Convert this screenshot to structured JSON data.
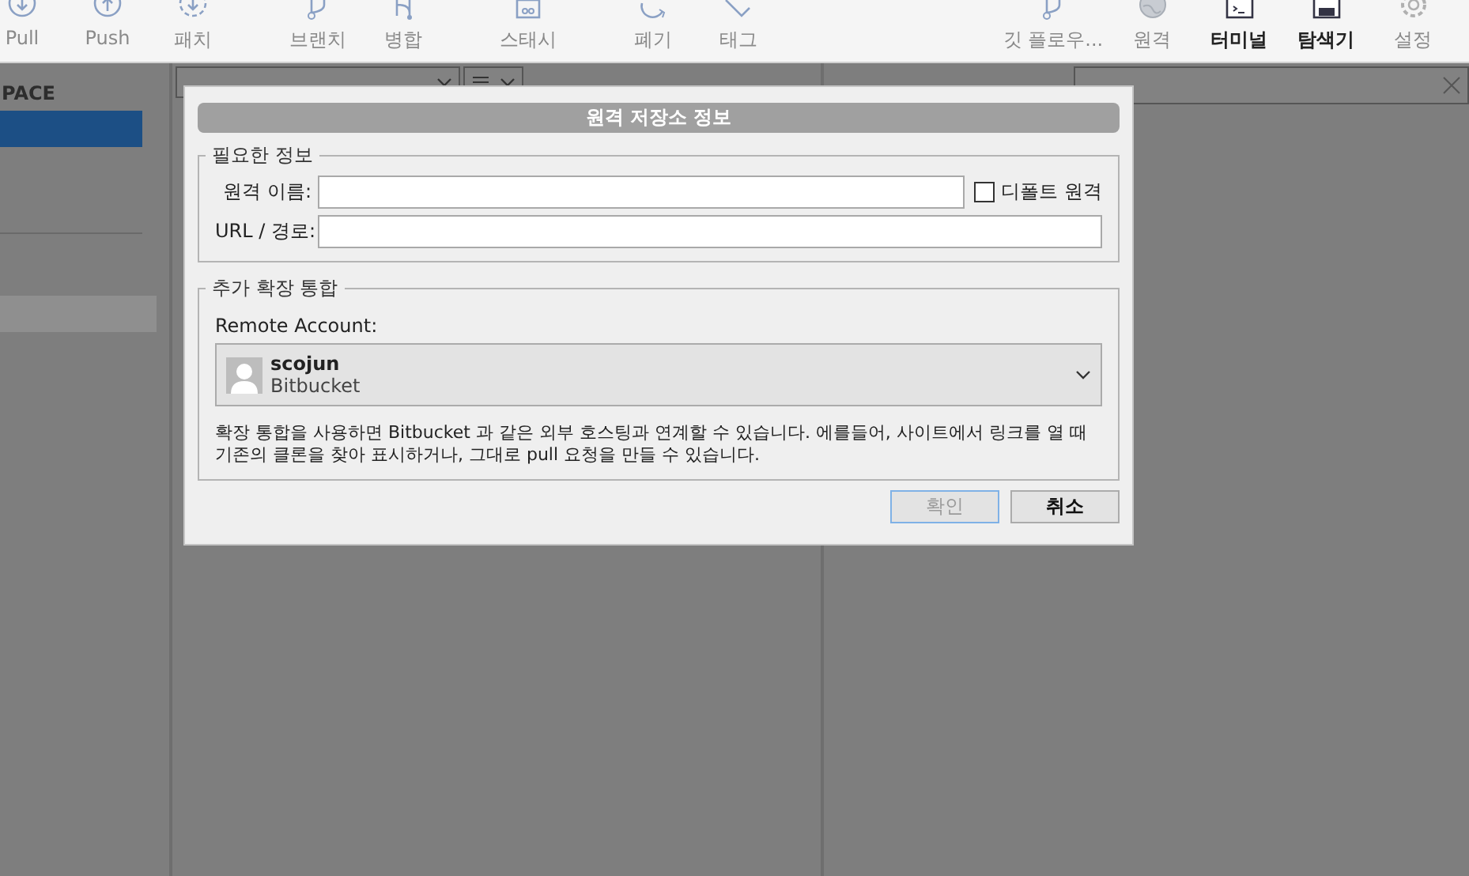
{
  "toolbar": {
    "left_groups": [
      [
        {
          "label": "Pull",
          "disabled": true
        },
        {
          "label": "Push",
          "disabled": true
        },
        {
          "label": "패치",
          "disabled": true
        }
      ],
      [
        {
          "label": "브랜치",
          "disabled": true
        },
        {
          "label": "병합",
          "disabled": true
        }
      ],
      [
        {
          "label": "스태시",
          "disabled": true
        }
      ],
      [
        {
          "label": "폐기",
          "disabled": true
        },
        {
          "label": "태그",
          "disabled": true
        }
      ]
    ],
    "right_items": [
      {
        "label": "깃 플로우...",
        "disabled": true
      },
      {
        "label": "원격",
        "disabled": true
      },
      {
        "label": "터미널",
        "disabled": false
      },
      {
        "label": "탐색기",
        "disabled": false
      },
      {
        "label": "설정",
        "disabled": true
      }
    ]
  },
  "sidebar": {
    "header": "PACE",
    "items": [
      {
        "selected": true,
        "highlighted": false
      },
      {
        "selected": false,
        "highlighted": true
      }
    ]
  },
  "dialog": {
    "title": "원격 저장소 정보",
    "required": {
      "legend": "필요한 정보",
      "name_label": "원격 이름:",
      "default_remote": {
        "label": "디폴트 원격",
        "checked": false
      },
      "url_label": "URL / 경로:"
    },
    "integration": {
      "legend": "추가 확장 통합",
      "account_label": "Remote Account:",
      "account": {
        "name": "scojun",
        "service": "Bitbucket"
      },
      "description": "확장 통합을 사용하면 Bitbucket 과 같은 외부 호스팅과 연계할 수 있습니다. 에를들어, 사이트에서 링크를 열 때\n기존의 클론을 찾아 표시하거나, 그대로 pull 요청을 만들 수 있습니다."
    },
    "buttons": [
      {
        "label": "확인",
        "disabled": true
      },
      {
        "label": "취소",
        "disabled": false
      }
    ]
  }
}
